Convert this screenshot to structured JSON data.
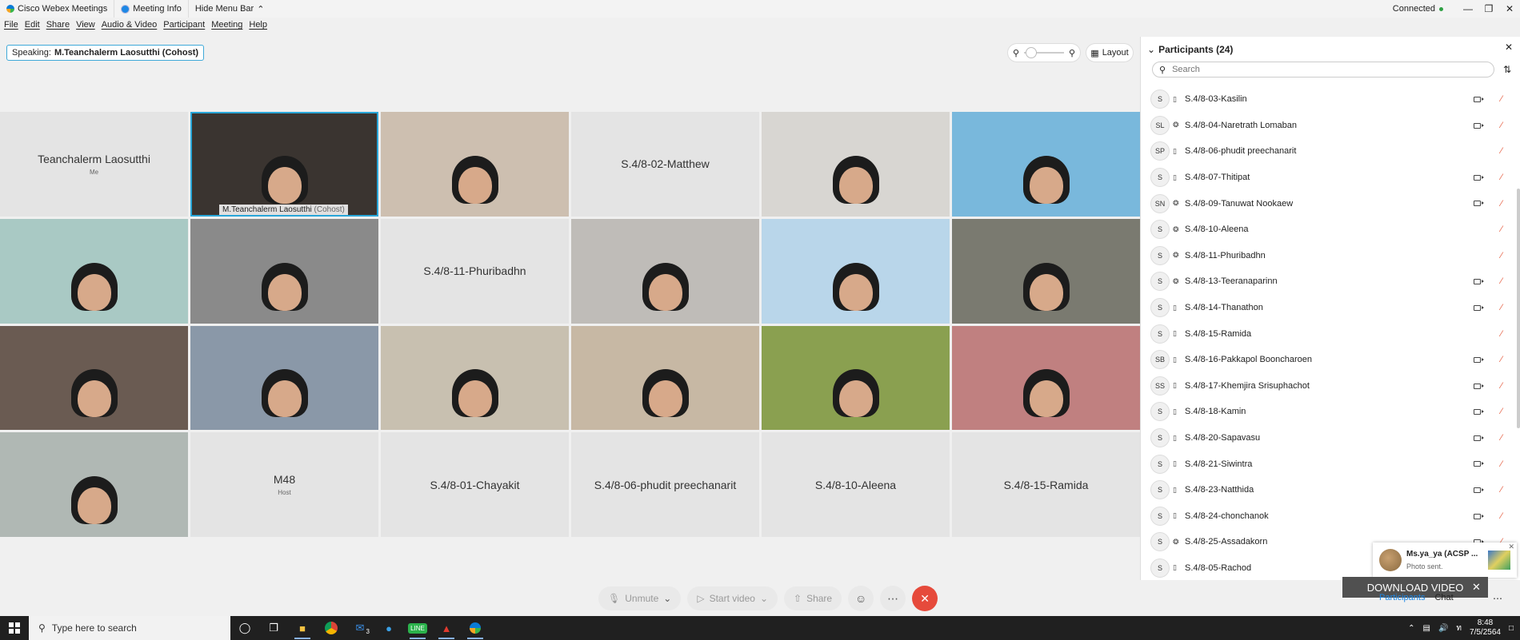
{
  "titlebar": {
    "app_title": "Cisco Webex Meetings",
    "meeting_info": "Meeting Info",
    "hide_menu": "Hide Menu Bar",
    "status": "Connected"
  },
  "menu": [
    "File",
    "Edit",
    "Share",
    "View",
    "Audio & Video",
    "Participant",
    "Meeting",
    "Help"
  ],
  "speaking": {
    "label": "Speaking:",
    "name": "M.Teanchalerm Laosutthi (Cohost)"
  },
  "layout_label": "Layout",
  "tiles": [
    {
      "name": "Teanchalerm Laosutthi",
      "sub": "Me",
      "type": "name"
    },
    {
      "caption": "M.Teanchalerm Laosutthi",
      "caption_role": "(Cohost)",
      "type": "video",
      "bg": "#3a3430",
      "active": true
    },
    {
      "type": "video",
      "bg": "#cdbfb0"
    },
    {
      "name": "S.4/8-02-Matthew",
      "type": "name"
    },
    {
      "type": "video",
      "bg": "#d8d6d2"
    },
    {
      "type": "video",
      "bg": "#79b8dc"
    },
    {
      "type": "video",
      "bg": "#a9c9c4"
    },
    {
      "type": "video",
      "bg": "#8a8a8a"
    },
    {
      "name": "S.4/8-11-Phuribadhn",
      "type": "name"
    },
    {
      "type": "video",
      "bg": "#bfbcb8"
    },
    {
      "type": "video",
      "bg": "#b9d6ea"
    },
    {
      "type": "video",
      "bg": "#7a7a70"
    },
    {
      "type": "video",
      "bg": "#6a5b52"
    },
    {
      "type": "video",
      "bg": "#8a98a8"
    },
    {
      "type": "video",
      "bg": "#c8c0b0"
    },
    {
      "type": "video",
      "bg": "#c7b8a4"
    },
    {
      "type": "video",
      "bg": "#8aa050"
    },
    {
      "type": "video",
      "bg": "#c08080"
    },
    {
      "type": "video",
      "bg": "#b0b8b4"
    },
    {
      "name": "M48",
      "sub": "Host",
      "type": "name"
    },
    {
      "name": "S.4/8-01-Chayakit",
      "type": "name"
    },
    {
      "name": "S.4/8-06-phudit preechanarit",
      "type": "name"
    },
    {
      "name": "S.4/8-10-Aleena",
      "type": "name"
    },
    {
      "name": "S.4/8-15-Ramida",
      "type": "name"
    }
  ],
  "controls": {
    "unmute": "Unmute",
    "start_video": "Start video",
    "share": "Share"
  },
  "panel": {
    "title": "Participants (24)",
    "search_placeholder": "Search",
    "participants": [
      {
        "initials": "S",
        "name": "S.4/8-03-Kasilin",
        "device": "phone",
        "video": true
      },
      {
        "initials": "SL",
        "name": "S.4/8-04-Naretrath Lomaban",
        "device": "headset",
        "video": true
      },
      {
        "initials": "SP",
        "name": "S.4/8-06-phudit preechanarit",
        "device": "phone",
        "video": false
      },
      {
        "initials": "S",
        "name": "S.4/8-07-Thitipat",
        "device": "phone",
        "video": true
      },
      {
        "initials": "SN",
        "name": "S.4/8-09-Tanuwat Nookaew",
        "device": "headset",
        "video": true
      },
      {
        "initials": "S",
        "name": "S.4/8-10-Aleena",
        "device": "headset",
        "video": false
      },
      {
        "initials": "S",
        "name": "S.4/8-11-Phuribadhn",
        "device": "headset",
        "video": false
      },
      {
        "initials": "S",
        "name": "S.4/8-13-Teeranaparinn",
        "device": "headset",
        "video": true
      },
      {
        "initials": "S",
        "name": "S.4/8-14-Thanathon",
        "device": "phone",
        "video": true
      },
      {
        "initials": "S",
        "name": "S.4/8-15-Ramida",
        "device": "phone",
        "video": false
      },
      {
        "initials": "SB",
        "name": "S.4/8-16-Pakkapol Booncharoen",
        "device": "phone",
        "video": true
      },
      {
        "initials": "SS",
        "name": "S.4/8-17-Khemjira Srisuphachot",
        "device": "phone",
        "video": true
      },
      {
        "initials": "S",
        "name": "S.4/8-18-Kamin",
        "device": "phone",
        "video": true
      },
      {
        "initials": "S",
        "name": "S.4/8-20-Sapavasu",
        "device": "phone",
        "video": true
      },
      {
        "initials": "S",
        "name": "S.4/8-21-Siwintra",
        "device": "phone",
        "video": true
      },
      {
        "initials": "S",
        "name": "S.4/8-23-Natthida",
        "device": "phone",
        "video": true
      },
      {
        "initials": "S",
        "name": "S.4/8-24-chonchanok",
        "device": "phone",
        "video": true
      },
      {
        "initials": "S",
        "name": "S.4/8-25-Assadakorn",
        "device": "headset",
        "video": true
      },
      {
        "initials": "S",
        "name": "S.4/8-05-Rachod",
        "device": "phone",
        "video": false
      }
    ]
  },
  "toast": {
    "title": "Ms.ya_ya (ACSP ...",
    "message": "Photo sent."
  },
  "download": "DOWNLOAD VIDEO",
  "bottom_tabs": {
    "participants": "Participants",
    "chat": "Chat"
  },
  "taskbar": {
    "search_placeholder": "Type here to search",
    "mail_badge": "3",
    "time": "8:48",
    "date": "7/5/2564"
  },
  "colors": {
    "accent": "#29a6d8",
    "end_call": "#e64a3b",
    "muted_mic": "#e55a3c"
  }
}
